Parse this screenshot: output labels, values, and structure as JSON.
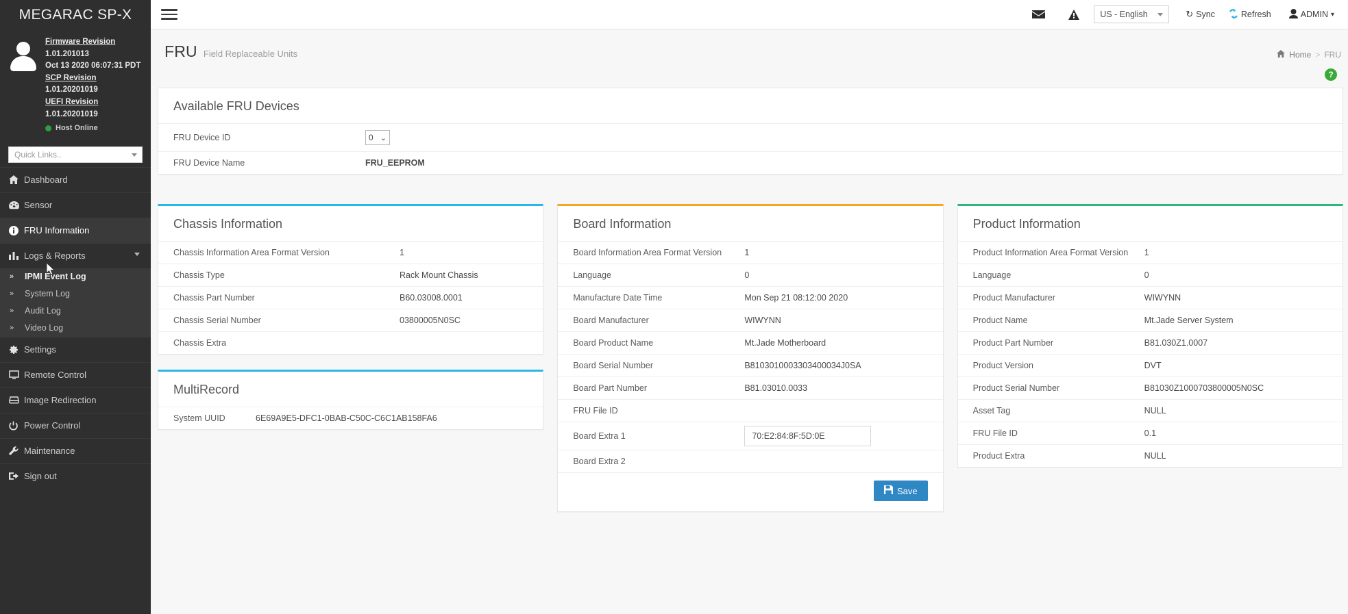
{
  "sidebar": {
    "brand": "MEGARAC SP-X",
    "firmware": [
      {
        "label": "Firmware Revision",
        "value": "1.01.201013"
      },
      {
        "label": "",
        "value": "Oct 13 2020 06:07:31 PDT"
      },
      {
        "label": "SCP Revision",
        "value": "1.01.20201019"
      },
      {
        "label": "UEFI Revision",
        "value": "1.01.20201019"
      }
    ],
    "host_status": "Host Online",
    "host_status_color": "#2e9e3e",
    "quick_links_placeholder": "Quick Links..",
    "items": [
      {
        "label": "Dashboard",
        "icon": "home-icon",
        "active": false
      },
      {
        "label": "Sensor",
        "icon": "sensor-icon",
        "active": false
      },
      {
        "label": "FRU Information",
        "icon": "info-icon",
        "active": true
      },
      {
        "label": "Logs & Reports",
        "icon": "chart-bar-icon",
        "active": false,
        "expanded": true
      },
      {
        "label": "Settings",
        "icon": "gear-icon",
        "active": false
      },
      {
        "label": "Remote Control",
        "icon": "monitor-icon",
        "active": false
      },
      {
        "label": "Image Redirection",
        "icon": "disk-icon",
        "active": false
      },
      {
        "label": "Power Control",
        "icon": "power-icon",
        "active": false
      },
      {
        "label": "Maintenance",
        "icon": "wrench-icon",
        "active": false
      },
      {
        "label": "Sign out",
        "icon": "sign-out-icon",
        "active": false
      }
    ],
    "logs_submenu": [
      {
        "label": "IPMI Event Log"
      },
      {
        "label": "System Log"
      },
      {
        "label": "Audit Log"
      },
      {
        "label": "Video Log"
      }
    ]
  },
  "topbar": {
    "language": "US - English",
    "sync_label": "Sync",
    "refresh_label": "Refresh",
    "user": "ADMIN",
    "mail_icon": "envelope-icon",
    "alert_icon": "warning-icon",
    "refresh_color": "#2ab0e8"
  },
  "page": {
    "title": "FRU",
    "subtitle": "Field Replaceable Units",
    "breadcrumb_home": "Home",
    "breadcrumb_sep": ">",
    "breadcrumb_current": "FRU",
    "help_glyph": "?"
  },
  "available_fru": {
    "title": "Available FRU Devices",
    "rows": [
      {
        "key": "FRU Device ID",
        "value": "0",
        "type": "select"
      },
      {
        "key": "FRU Device Name",
        "value": "FRU_EEPROM",
        "type": "text"
      }
    ]
  },
  "chassis": {
    "title": "Chassis Information",
    "accent": "#29b6e8",
    "rows": [
      {
        "key": "Chassis Information Area Format Version",
        "value": "1"
      },
      {
        "key": "Chassis Type",
        "value": "Rack Mount Chassis"
      },
      {
        "key": "Chassis Part Number",
        "value": "B60.03008.0001"
      },
      {
        "key": "Chassis Serial Number",
        "value": "03800005N0SC"
      },
      {
        "key": "Chassis Extra",
        "value": ""
      }
    ]
  },
  "multirecord": {
    "title": "MultiRecord",
    "accent": "#29b6e8",
    "rows": [
      {
        "key": "System UUID",
        "value": "6E69A9E5-DFC1-0BAB-C50C-C6C1AB158FA6"
      }
    ]
  },
  "board": {
    "title": "Board Information",
    "accent": "#f5a623",
    "rows": [
      {
        "key": "Board Information Area Format Version",
        "value": "1"
      },
      {
        "key": "Language",
        "value": "0"
      },
      {
        "key": "Manufacture Date Time",
        "value": "Mon Sep 21 08:12:00 2020"
      },
      {
        "key": "Board Manufacturer",
        "value": "WIWYNN"
      },
      {
        "key": "Board Product Name",
        "value": "Mt.Jade Motherboard"
      },
      {
        "key": "Board Serial Number",
        "value": "B8103010003303400034J0SA"
      },
      {
        "key": "Board Part Number",
        "value": "B81.03010.0033"
      },
      {
        "key": "FRU File ID",
        "value": ""
      }
    ],
    "extra1_label": "Board Extra 1",
    "extra1_value": "70:E2:84:8F:5D:0E",
    "extra2_label": "Board Extra 2",
    "extra2_value": "",
    "save_label": "Save",
    "save_icon": "floppy-disk-icon",
    "save_color": "#2f87c4"
  },
  "product": {
    "title": "Product Information",
    "accent": "#29b87d",
    "rows": [
      {
        "key": "Product Information Area Format Version",
        "value": "1"
      },
      {
        "key": "Language",
        "value": "0"
      },
      {
        "key": "Product Manufacturer",
        "value": "WIWYNN"
      },
      {
        "key": "Product Name",
        "value": "Mt.Jade Server System"
      },
      {
        "key": "Product Part Number",
        "value": "B81.030Z1.0007"
      },
      {
        "key": "Product Version",
        "value": "DVT"
      },
      {
        "key": "Product Serial Number",
        "value": "B81030Z1000703800005N0SC"
      },
      {
        "key": "Asset Tag",
        "value": "NULL"
      },
      {
        "key": "FRU File ID",
        "value": "0.1"
      },
      {
        "key": "Product Extra",
        "value": "NULL"
      }
    ]
  }
}
